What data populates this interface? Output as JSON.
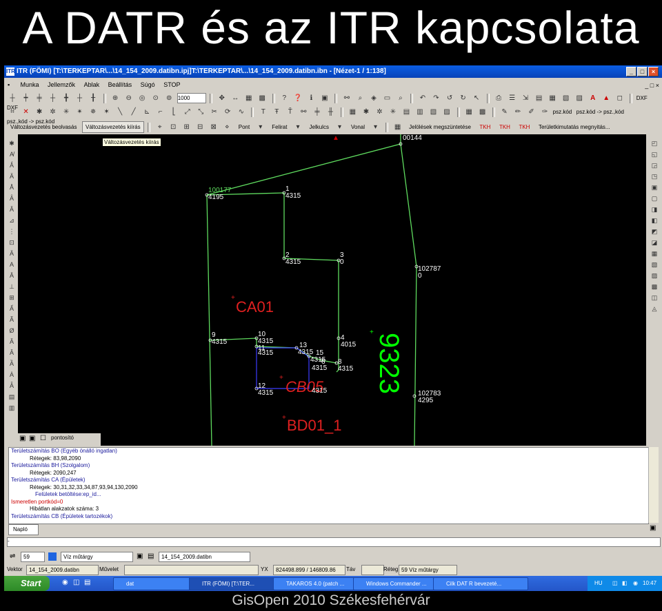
{
  "slide": {
    "title": "A DATR és az ITR kapcsolata",
    "footer": "GisOpen 2010 Székesfehérvár"
  },
  "window": {
    "title": "ITR (FÖMI) [T:\\TERKEPTAR\\...\\14_154_2009.datibn.ipj]T:\\TERKEPTAR\\...\\14_154_2009.datibn.ibn - [Nézet-1 / 1:138]",
    "app_icon": "ITR",
    "buttons": {
      "minimize": "_",
      "maximize": "□",
      "close": "×"
    }
  },
  "menu": {
    "items": [
      "Munka",
      "Jellemzők",
      "Ablak",
      "Beállítás",
      "Súgó",
      "STOP"
    ],
    "mdi_controls": "_ □ ×"
  },
  "toolbar1": {
    "zoom_value": "1000",
    "icons": [
      "snap-icon",
      "snap-icon",
      "snap-icon",
      "snap-icon",
      "snap-icon",
      "snap-icon",
      "snap-icon",
      "zoom-in-icon",
      "zoom-out-icon",
      "zoom-window-icon",
      "zoom-all-icon",
      "zoom-previous-icon",
      "pan-icon",
      "measure-icon",
      "help-icon",
      "info-icon",
      "binoculars-icon",
      "find-icon",
      "undo-icon",
      "redo-icon",
      "print-icon",
      "layers-icon",
      "export-icon",
      "text-icon",
      "warning-icon",
      "dxf-export-icon",
      "dxf-import-icon"
    ],
    "dxf_labels": [
      "DXF",
      "DXF"
    ]
  },
  "toolbar2": {
    "labels": [
      "psz.kód",
      "psz.kód -> psz.,kód",
      "psz.,kód -> psz.kód"
    ]
  },
  "toolbar3": {
    "buttons": [
      "Változásvezetés beolvasás",
      "Változásvezetés kiírás"
    ],
    "dropdowns": [
      "Pont",
      "Felirat",
      "Jelkulcs",
      "Vonal"
    ],
    "extra": [
      "Jelölések megszüntetése",
      "TKH",
      "TKH",
      "TKH",
      "Területkimutatás megnyitás..."
    ],
    "tooltip": "Változásvezetés kiírás"
  },
  "drawing": {
    "labels": {
      "p_top": "00144",
      "p_a_num": "100177",
      "p_a_val": "4195",
      "p1_num": "1",
      "p1_val": "4315",
      "p2_num": "2",
      "p2_val": "4315",
      "p3_num": "3",
      "p3_val": "0",
      "p102787": "102787",
      "p102787_val": "0",
      "ca01": "CA01",
      "p9_num": "9",
      "p9_val": "4315",
      "p10_num": "10",
      "p10_val": "4315",
      "p11_num": "11",
      "p11_val": "4315",
      "p13_num": "13",
      "p13_val": "4315",
      "p15_num": "15",
      "p15_val": "4315",
      "p14_val": "4315",
      "p4_num": "4",
      "p4_val": "4015",
      "p8_num": "8",
      "p8_val": "4315",
      "p6_num": "6",
      "p6_val": "4315",
      "p12_num": "12",
      "p12_val": "4315",
      "cb05": "CB05",
      "cb05_val": "4315",
      "bd01": "BD01_1",
      "parcel": "9323",
      "p102783": "102783",
      "p102783_val": "4295"
    }
  },
  "tabrow": {
    "label": "pontosító"
  },
  "log": {
    "lines": [
      {
        "text": "Területszámítás BO (Egyéb önálló ingatlan)",
        "cls": "blue"
      },
      {
        "text": "Rétegek: 83,98,2090",
        "cls": "i1"
      },
      {
        "text": "Területszámítás BH (Szolgalom)",
        "cls": "blue"
      },
      {
        "text": "Rétegek: 2090,247",
        "cls": "i1"
      },
      {
        "text": "Területszámítás CA (Épületek)",
        "cls": "blue"
      },
      {
        "text": "Rétegek: 30,31,32,33,34,87,93,94,130,2090",
        "cls": "i1"
      },
      {
        "text": "Felületek betöltése:ep_id...",
        "cls": "i2"
      },
      {
        "text": "Ismeretlen portkód=0",
        "cls": "red"
      },
      {
        "text": "Hibátlan alakzatok száma: 3",
        "cls": "i1"
      },
      {
        "text": "Területszámítás CB (Épületek tartozékok)",
        "cls": "blue"
      }
    ],
    "tab": "Napló"
  },
  "strip": {
    "text": "-"
  },
  "layerbar": {
    "layer_num": "59",
    "layer_name": "Víz műtárgy",
    "file": "14_154_2009.datibn"
  },
  "statusbar": {
    "vektor_label": "Vektor",
    "vektor_value": "14_154_2009.datibn",
    "muvelet_label": "Művelet",
    "xy_label": "YX",
    "xy_value": "824498.899 / 146809.86",
    "tav_label": "Táv",
    "reteg_label": "Réteg",
    "reteg_value": "59  Víz műtárgy"
  },
  "taskbar": {
    "start": "Start",
    "tasks": [
      {
        "label": "dat"
      },
      {
        "label": "ITR (FÖMI) [T:\\TER..."
      },
      {
        "label": "TAKAROS 4.0 (patch ..."
      },
      {
        "label": "Windows Commander ..."
      },
      {
        "label": "Cilk DAT R bevezeté..."
      }
    ],
    "lang": "HU",
    "clock": "10:47"
  },
  "colors": {
    "boundary": "#5fdc5f",
    "highlight_green": "#00ff00",
    "label_red": "#e02020",
    "building_blue": "#3c3cff",
    "canvas": "#000000"
  }
}
